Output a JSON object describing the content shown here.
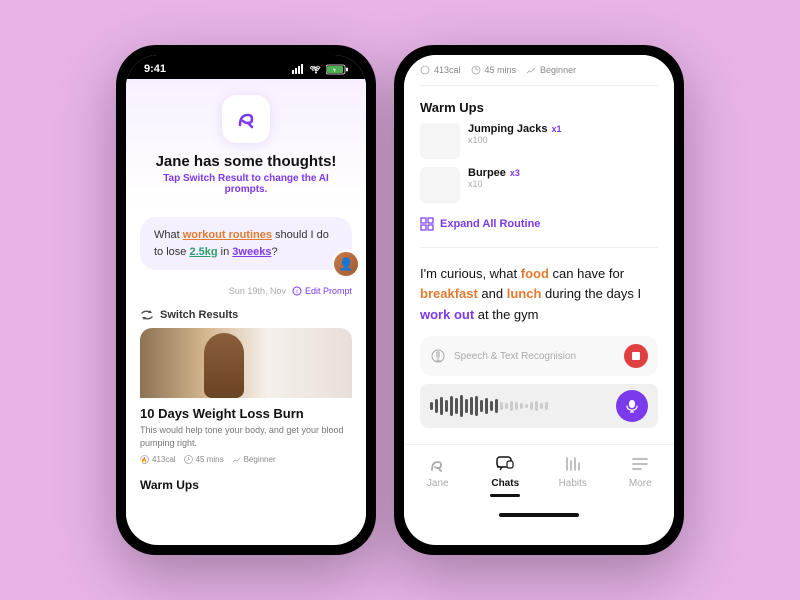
{
  "background_color": "#e8b4e8",
  "phone_left": {
    "status_bar": {
      "time": "9:41"
    },
    "greeting": {
      "title": "Jane has some thoughts!",
      "subtitle": "Tap",
      "switch_text": "Switch Result",
      "subtitle_end": "to change the AI prompts."
    },
    "chat_bubble": {
      "text_parts": [
        "What ",
        "workout routines",
        " should I do to lose ",
        "2.5kg",
        " in ",
        "3weeks",
        "?"
      ]
    },
    "chat_meta": {
      "date": "Sun 19th, Nov",
      "edit_label": "Edit Prompt"
    },
    "switch_results": {
      "label": "Switch Results"
    },
    "workout_card": {
      "title": "10 Days Weight Loss Burn",
      "description": "This would help tone your body, and get your blood pumping right.",
      "calories": "413cal",
      "duration": "45 mins",
      "level": "Beginner"
    },
    "warm_ups": {
      "title": "Warm Ups"
    }
  },
  "phone_right": {
    "workout_stats": {
      "calories": "413cal",
      "duration": "45 mins",
      "level": "Beginner"
    },
    "warm_ups": {
      "title": "Warm Ups",
      "exercises": [
        {
          "name": "Jumping Jacks",
          "badge": "x1",
          "count": "x100"
        },
        {
          "name": "Burpee",
          "badge": "x3",
          "count": "x10"
        }
      ],
      "expand_label": "Expand All Routine"
    },
    "ai_response": {
      "text": "I'm curious, what food can have for breakfast and lunch during the days I work out at the gym"
    },
    "speech": {
      "label": "Speech & Text Recognision"
    },
    "bottom_nav": {
      "items": [
        {
          "label": "Jane",
          "active": false
        },
        {
          "label": "Chats",
          "active": true
        },
        {
          "label": "Habits",
          "active": false
        },
        {
          "label": "More",
          "active": false
        }
      ]
    }
  }
}
